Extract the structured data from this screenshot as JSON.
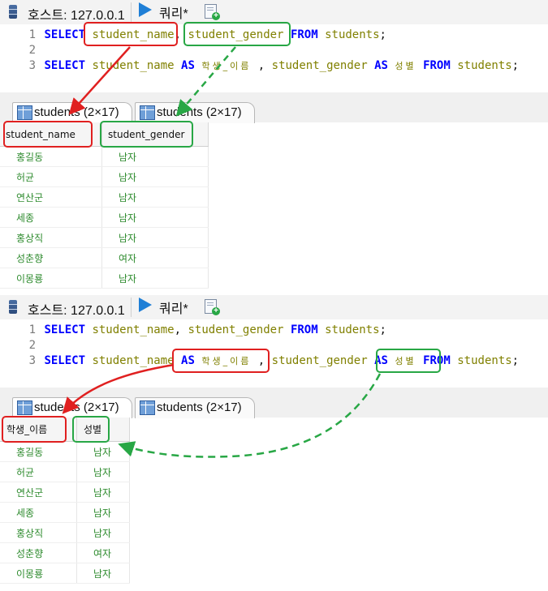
{
  "panels": [
    {
      "host_label": "호스트: 127.0.0.1",
      "query_tab_label": "쿼리*",
      "code": {
        "line1_no": "1",
        "line2_no": "2",
        "line3_no": "3",
        "select_kw": "SELECT",
        "from_kw": "FROM",
        "as_kw": "AS",
        "col_name": "student_name",
        "col_gender": "student_gender",
        "table": "students",
        "comma": ",",
        "semicolon": ";",
        "alias_name": "학생_이름",
        "alias_gender": "성별"
      },
      "result_tabs": [
        "students (2×17)",
        "students (2×17)"
      ],
      "columns": [
        "student_name",
        "student_gender"
      ],
      "rows": [
        [
          "홍길동",
          "남자"
        ],
        [
          "허균",
          "남자"
        ],
        [
          "연산군",
          "남자"
        ],
        [
          "세종",
          "남자"
        ],
        [
          "홍상직",
          "남자"
        ],
        [
          "성춘향",
          "여자"
        ],
        [
          "이몽룡",
          "남자"
        ]
      ]
    },
    {
      "host_label": "호스트: 127.0.0.1",
      "query_tab_label": "쿼리*",
      "code": {
        "line1_no": "1",
        "line2_no": "2",
        "line3_no": "3",
        "select_kw": "SELECT",
        "from_kw": "FROM",
        "as_kw": "AS",
        "col_name": "student_name",
        "col_gender": "student_gender",
        "table": "students",
        "comma": ",",
        "semicolon": ";",
        "alias_name": "학생_이름",
        "alias_gender": "성별"
      },
      "result_tabs": [
        "students (2×17)",
        "students (2×17)"
      ],
      "columns": [
        "학생_이름",
        "성별"
      ],
      "rows": [
        [
          "홍길동",
          "남자"
        ],
        [
          "허균",
          "남자"
        ],
        [
          "연산군",
          "남자"
        ],
        [
          "세종",
          "남자"
        ],
        [
          "홍상직",
          "남자"
        ],
        [
          "성춘향",
          "여자"
        ],
        [
          "이몽룡",
          "남자"
        ]
      ]
    }
  ],
  "colors": {
    "highlight_red": "#e02020",
    "highlight_green": "#28a745",
    "keyword": "#0000ff",
    "identifier": "#808000",
    "cell_text": "#2e8b2e"
  },
  "icons": [
    "database-icon",
    "run-query-icon",
    "new-query-icon",
    "result-grid-icon"
  ]
}
